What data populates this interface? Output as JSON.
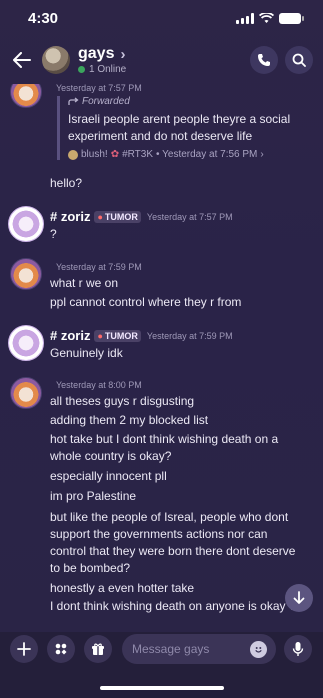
{
  "status": {
    "time": "4:30"
  },
  "header": {
    "channel_name": "gays",
    "chevron": "›",
    "online_text": "1 Online",
    "icons": [
      "arrow-left-icon",
      "phone-icon",
      "search-icon"
    ]
  },
  "messages": [
    {
      "timestamp": "Yesterday at 7:57 PM",
      "forwarded": {
        "label": "Forwarded",
        "text": "Israeli people arent people theyre a social experiment and do not deserve life",
        "source_user": "blush!",
        "source_channel": "#RT3K",
        "source_time": "• Yesterday at 7:56 PM",
        "source_chevron": "›"
      },
      "text": "hello?"
    },
    {
      "author": "# zoriz",
      "tag": "TUMOR",
      "timestamp": "Yesterday at 7:57 PM",
      "text": "?"
    },
    {
      "timestamp": "Yesterday at 7:59 PM",
      "lines": [
        "what r we on",
        "ppl cannot control where they r from"
      ]
    },
    {
      "author": "# zoriz",
      "tag": "TUMOR",
      "timestamp": "Yesterday at 7:59 PM",
      "text": "Genuinely idk"
    },
    {
      "timestamp": "Yesterday at 8:00 PM",
      "lines": [
        "all theses guys r disgusting",
        "adding them 2 my blocked list",
        "hot take but I dont think wishing death on a whole country is okay?",
        "especially innocent pll",
        "im pro Palestine",
        "but like the people of Isreal, people who dont support the governments actions nor can control that they were born there dont deserve to be bombed?",
        "honestly a even hotter take",
        "I dont think wishing death on anyone is okay ??"
      ]
    }
  ],
  "composer": {
    "placeholder": "Message gays"
  },
  "colors": {
    "background": "#2b2447",
    "accent": "#5c5580",
    "online": "#3ba55d"
  }
}
